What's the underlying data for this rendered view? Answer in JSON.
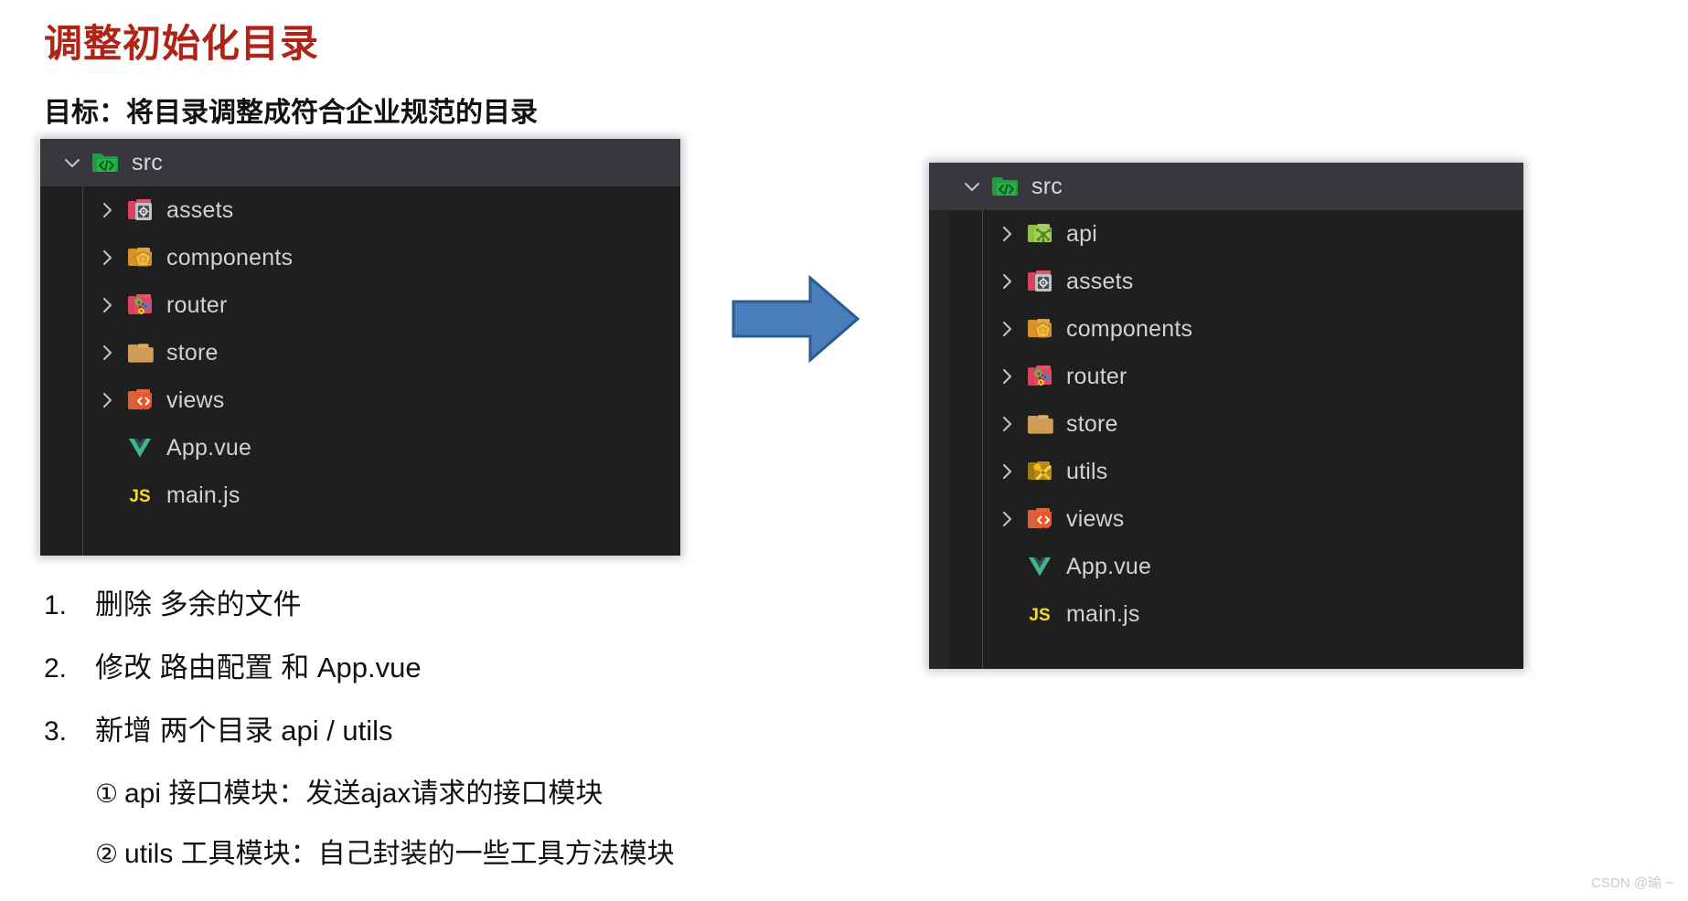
{
  "slide": {
    "title": "调整初始化目录",
    "subtitle": "目标：将目录调整成符合企业规范的目录",
    "watermark": "CSDN @瑜 ~"
  },
  "colors": {
    "title_red": "#B02418",
    "panel_bg": "#1F1F1F",
    "panel_header_bg": "#37373D",
    "panel_chrome": "#252526",
    "label_text": "#CFD2D6",
    "arrow_fill": "#4A7EBB",
    "arrow_stroke": "#2E5B8F",
    "page_bg": "#FFFFFF"
  },
  "before_panel": {
    "name": "before-file-tree",
    "root": {
      "label": "src",
      "icon": "folder-src-icon",
      "chevron": "chevron-down-icon"
    },
    "items": [
      {
        "label": "assets",
        "icon": "folder-assets-icon",
        "chevron": "chevron-right-icon"
      },
      {
        "label": "components",
        "icon": "folder-components-icon",
        "chevron": "chevron-right-icon"
      },
      {
        "label": "router",
        "icon": "folder-router-icon",
        "chevron": "chevron-right-icon"
      },
      {
        "label": "store",
        "icon": "folder-plain-icon",
        "chevron": "chevron-right-icon"
      },
      {
        "label": "views",
        "icon": "folder-views-icon",
        "chevron": "chevron-right-icon"
      },
      {
        "label": "App.vue",
        "icon": "vue-file-icon",
        "chevron": "none"
      },
      {
        "label": "main.js",
        "icon": "js-file-icon",
        "chevron": "none"
      }
    ]
  },
  "after_panel": {
    "name": "after-file-tree",
    "root": {
      "label": "src",
      "icon": "folder-src-icon",
      "chevron": "chevron-down-icon"
    },
    "items": [
      {
        "label": "api",
        "icon": "folder-api-icon",
        "chevron": "chevron-right-icon"
      },
      {
        "label": "assets",
        "icon": "folder-assets-icon",
        "chevron": "chevron-right-icon"
      },
      {
        "label": "components",
        "icon": "folder-components-icon",
        "chevron": "chevron-right-icon"
      },
      {
        "label": "router",
        "icon": "folder-router-icon",
        "chevron": "chevron-right-icon"
      },
      {
        "label": "store",
        "icon": "folder-plain-icon",
        "chevron": "chevron-right-icon"
      },
      {
        "label": "utils",
        "icon": "folder-utils-icon",
        "chevron": "chevron-right-icon"
      },
      {
        "label": "views",
        "icon": "folder-views-icon",
        "chevron": "chevron-right-icon"
      },
      {
        "label": "App.vue",
        "icon": "vue-file-icon",
        "chevron": "none"
      },
      {
        "label": "main.js",
        "icon": "js-file-icon",
        "chevron": "none"
      }
    ]
  },
  "arrow": {
    "icon": "right-block-arrow-icon"
  },
  "notes": {
    "items": [
      {
        "num": "1.",
        "text": "删除 多余的文件"
      },
      {
        "num": "2.",
        "text": "修改 路由配置 和 App.vue"
      },
      {
        "num": "3.",
        "text": "新增 两个目录 api / utils"
      }
    ],
    "sub_items": [
      {
        "mark": "①",
        "text": "api 接口模块：发送ajax请求的接口模块"
      },
      {
        "mark": "②",
        "text": "utils 工具模块：自己封装的一些工具方法模块"
      }
    ]
  }
}
